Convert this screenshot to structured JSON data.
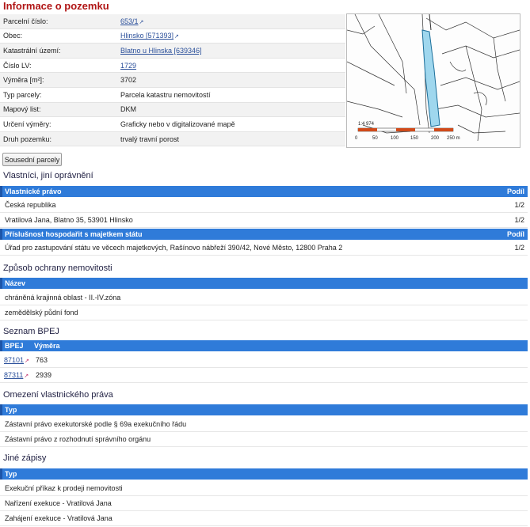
{
  "title": "Informace o pozemku",
  "info_rows": [
    {
      "label": "Parcelní číslo:",
      "value": "653/1",
      "link": true
    },
    {
      "label": "Obec:",
      "value": "Hlinsko [571393]",
      "link": true
    },
    {
      "label": "Katastrální území:",
      "value": "Blatno u Hlinska [639346]",
      "link": true,
      "noicon": true
    },
    {
      "label": "Číslo LV:",
      "value": "1729",
      "link": true,
      "noicon": true
    },
    {
      "label": "Výměra [m²]:",
      "value": "3702"
    },
    {
      "label": "Typ parcely:",
      "value": "Parcela katastru nemovitostí"
    },
    {
      "label": "Mapový list:",
      "value": "DKM"
    },
    {
      "label": "Určení výměry:",
      "value": "Graficky nebo v digitalizované mapě"
    },
    {
      "label": "Druh pozemku:",
      "value": "trvalý travní porost"
    }
  ],
  "map": {
    "scale_label": "1:4 974",
    "scale_ticks": [
      "0",
      "50",
      "100",
      "150",
      "200",
      "250 m"
    ]
  },
  "neighbors_button": "Sousední parcely",
  "owners": {
    "heading": "Vlastníci, jiní oprávnění",
    "header1": {
      "col1": "Vlastnické právo",
      "col2": "Podíl"
    },
    "rows1": [
      {
        "name": "Česká republika",
        "share": "1/2"
      },
      {
        "name": "Vratilová Jana, Blatno 35, 53901 Hlinsko",
        "share": "1/2"
      }
    ],
    "header2": {
      "col1": "Příslušnost hospodařit s majetkem státu",
      "col2": "Podíl"
    },
    "rows2": [
      {
        "name": "Úřad pro zastupování státu ve věcech majetkových, Rašínovo nábřeží 390/42, Nové Město, 12800 Praha 2",
        "share": "1/2"
      }
    ]
  },
  "protection": {
    "heading": "Způsob ochrany nemovitosti",
    "header": "Název",
    "rows": [
      "chráněná krajinná oblast - II.-IV.zóna",
      "zemědělský půdní fond"
    ]
  },
  "bpej": {
    "heading": "Seznam BPEJ",
    "header": {
      "col1": "BPEJ",
      "col2": "Výměra"
    },
    "rows": [
      {
        "code": "87101",
        "area": "763"
      },
      {
        "code": "87311",
        "area": "2939"
      }
    ]
  },
  "restrictions": {
    "heading": "Omezení vlastnického práva",
    "header": "Typ",
    "rows": [
      "Zástavní právo exekutorské podle § 69a exekučního řádu",
      "Zástavní právo z rozhodnutí správního orgánu"
    ]
  },
  "other": {
    "heading": "Jiné zápisy",
    "header": "Typ",
    "rows": [
      "Exekuční příkaz k prodeji nemovitosti",
      "Nařízení exekuce - Vratilová Jana",
      "Zahájení exekuce - Vratilová Jana"
    ]
  }
}
